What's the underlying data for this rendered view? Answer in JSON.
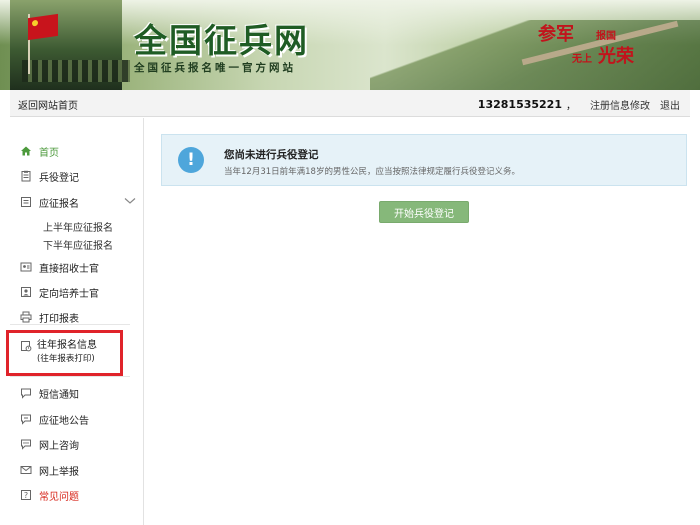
{
  "banner": {
    "site_title": "全国征兵网",
    "site_subtitle": "全国征兵报名唯一官方网站",
    "slogan_1": "参军",
    "slogan_2": "报国",
    "slogan_3": "无上",
    "slogan_4": "光荣"
  },
  "topbar": {
    "back_link": "返回网站首页",
    "phone": "13281535221",
    "comma": "，",
    "edit_link": "注册信息修改",
    "logout_link": "退出"
  },
  "sidebar": {
    "items": [
      {
        "label": "首页",
        "icon": "home-icon"
      },
      {
        "label": "兵役登记",
        "icon": "clipboard-icon"
      },
      {
        "label": "应征报名",
        "icon": "document-icon"
      },
      {
        "label": "直接招收士官",
        "icon": "id-card-icon"
      },
      {
        "label": "定向培养士官",
        "icon": "person-card-icon"
      },
      {
        "label": "打印报表",
        "icon": "printer-icon"
      },
      {
        "label": "往年报名信息",
        "sub_label": "(往年报表打印)",
        "icon": "history-doc-icon"
      },
      {
        "label": "短信通知",
        "icon": "chat-icon"
      },
      {
        "label": "应征地公告",
        "icon": "announcement-icon"
      },
      {
        "label": "网上咨询",
        "icon": "chat-icon"
      },
      {
        "label": "网上举报",
        "icon": "mail-icon"
      },
      {
        "label": "常见问题",
        "icon": "question-icon"
      }
    ],
    "sub_items": [
      "上半年应征报名",
      "下半年应征报名"
    ]
  },
  "notice": {
    "title": "您尚未进行兵役登记",
    "description": "当年12月31日前年满18岁的男性公民，应当按照法律规定履行兵役登记义务。",
    "icon": "info-icon"
  },
  "main": {
    "start_button": "开始兵役登记"
  },
  "colors": {
    "accent_green": "#4c9a3c",
    "button_green": "#86b87a",
    "highlight_red": "#e0232a",
    "notice_bg": "#e6f2f8",
    "info_blue": "#4ea6db"
  }
}
